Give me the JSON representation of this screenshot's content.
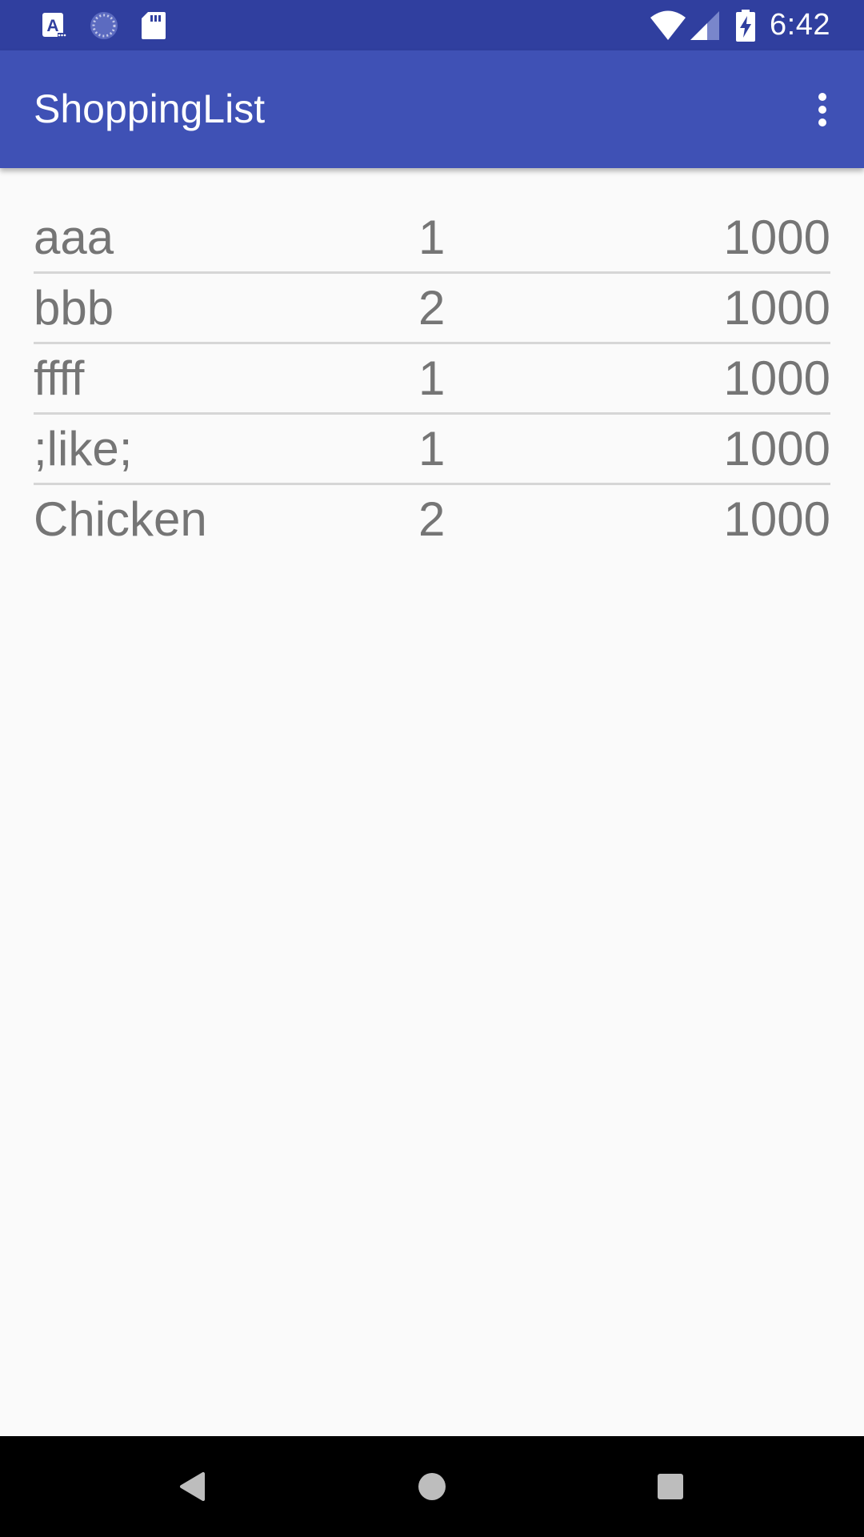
{
  "status_bar": {
    "time": "6:42",
    "icons": [
      "text-a-icon",
      "sync-spinner-icon",
      "sd-card-icon",
      "wifi-icon",
      "cellular-signal-icon",
      "battery-charging-icon"
    ]
  },
  "app_bar": {
    "title": "ShoppingList",
    "overflow_icon": "more-vert-icon"
  },
  "items": [
    {
      "name": "aaa",
      "quantity": "1",
      "price": "1000"
    },
    {
      "name": "bbb",
      "quantity": "2",
      "price": "1000"
    },
    {
      "name": "ffff",
      "quantity": "1",
      "price": "1000"
    },
    {
      "name": ";like;",
      "quantity": "1",
      "price": "1000"
    },
    {
      "name": "Chicken",
      "quantity": "2",
      "price": "1000"
    }
  ],
  "nav_bar": {
    "icons": [
      "back-icon",
      "home-icon",
      "recents-icon"
    ]
  },
  "colors": {
    "status_bar": "#303f9f",
    "app_bar": "#3f51b5",
    "background": "#fafafa",
    "text": "#757575",
    "divider": "#d6d6d6",
    "nav_bar": "#000000"
  }
}
